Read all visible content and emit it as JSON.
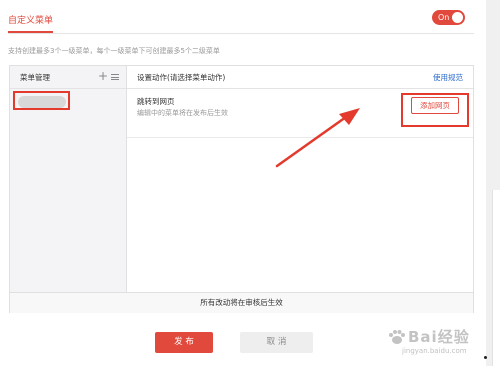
{
  "tabs": {
    "active_label": "自定义菜单"
  },
  "toggle": {
    "label": "On",
    "state": "on"
  },
  "hint": "支持创建最多3个一级菜单，每个一级菜单下可创建最多5个二级菜单",
  "menu_management": {
    "title": "菜单管理",
    "add_icon": "plus-icon",
    "sort_icon": "sort-icon",
    "items": [
      {
        "label": ""
      }
    ]
  },
  "settings": {
    "title": "设置动作(请选择菜单动作)",
    "usage_link": "使用规范",
    "action": {
      "title": "跳转到网页",
      "description": "编辑中的菜单将在发布后生效",
      "add_button": "添加网页"
    }
  },
  "footer_note": "所有改动将在审核后生效",
  "buttons": {
    "publish": "发 布",
    "cancel": "取 消"
  },
  "watermark": {
    "brand": "Bai经验",
    "url": "jingyan.baidu.com"
  },
  "colors": {
    "accent": "#e0493c",
    "link": "#2b6ac9",
    "annotation": "#e33a2d"
  }
}
